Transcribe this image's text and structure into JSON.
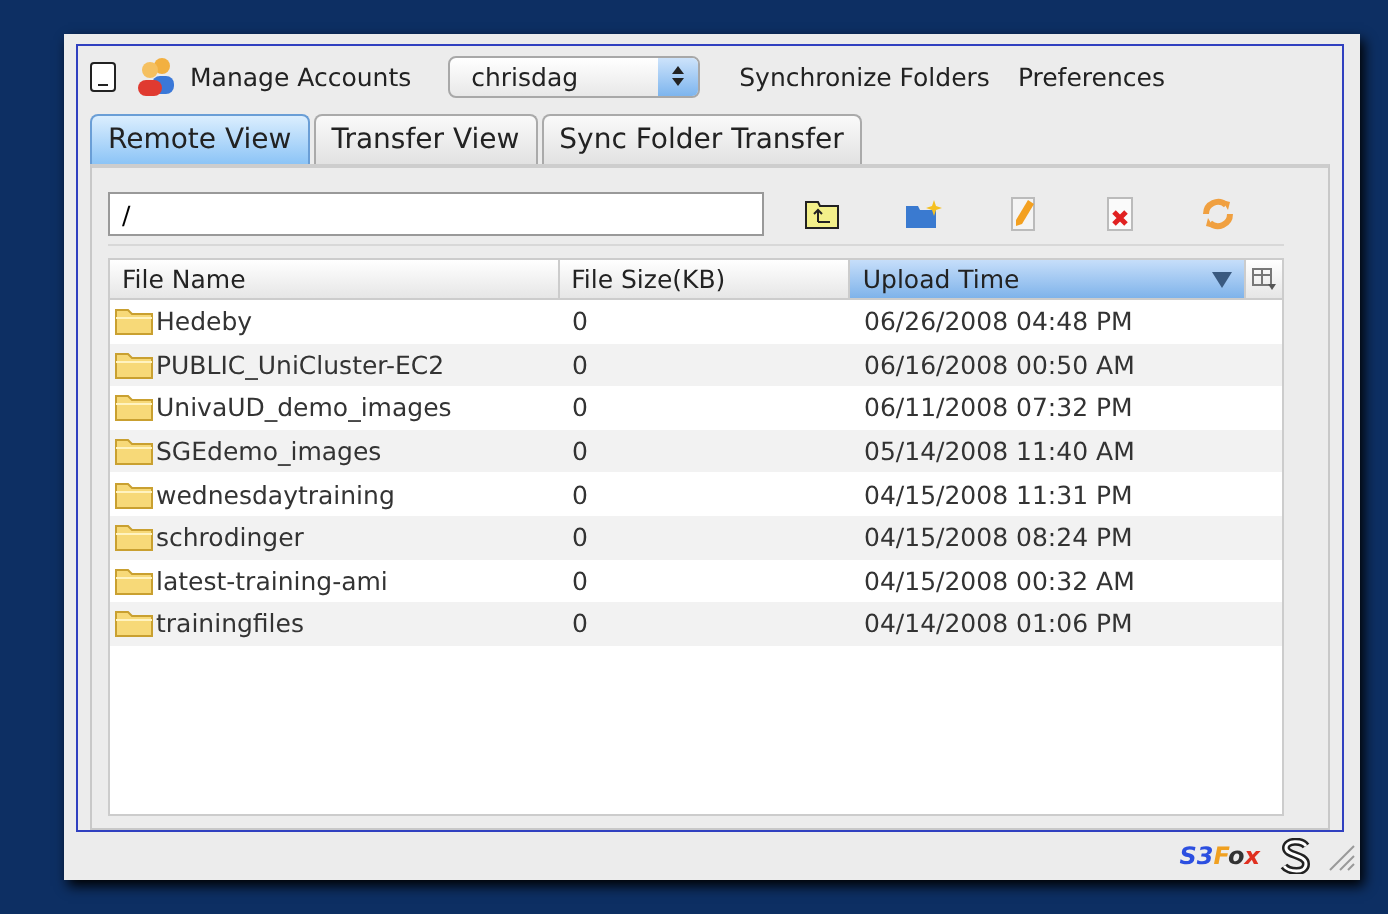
{
  "toolbar": {
    "manage_accounts": "Manage Accounts",
    "account": "chrisdag",
    "sync_folders": "Synchronize Folders",
    "preferences": "Preferences"
  },
  "tabs": [
    {
      "label": "Remote View",
      "selected": true
    },
    {
      "label": "Transfer View",
      "selected": false
    },
    {
      "label": "Sync Folder Transfer",
      "selected": false
    }
  ],
  "path": "/",
  "table": {
    "columns": [
      {
        "label": "File Name",
        "sorted": false
      },
      {
        "label": "File Size(KB)",
        "sorted": false
      },
      {
        "label": "Upload Time",
        "sorted": true
      }
    ],
    "rows": [
      {
        "name": "Hedeby",
        "size": "0",
        "time": "06/26/2008 04:48 PM"
      },
      {
        "name": "PUBLIC_UniCluster-EC2",
        "size": "0",
        "time": "06/16/2008 00:50 AM"
      },
      {
        "name": "UnivaUD_demo_images",
        "size": "0",
        "time": "06/11/2008 07:32 PM"
      },
      {
        "name": "SGEdemo_images",
        "size": "0",
        "time": "05/14/2008 11:40 AM"
      },
      {
        "name": "wednesdaytraining",
        "size": "0",
        "time": "04/15/2008 11:31 PM"
      },
      {
        "name": "schrodinger",
        "size": "0",
        "time": "04/15/2008 08:24 PM"
      },
      {
        "name": "latest-training-ami",
        "size": "0",
        "time": "04/15/2008 00:32 AM"
      },
      {
        "name": "trainingfiles",
        "size": "0",
        "time": "04/14/2008 01:06 PM"
      }
    ]
  },
  "logo": [
    {
      "text": "S3",
      "color": "#2c4fe0"
    },
    {
      "text": "F",
      "color": "#f0a020"
    },
    {
      "text": "o",
      "color": "#333333"
    },
    {
      "text": "x",
      "color": "#e03020"
    }
  ]
}
